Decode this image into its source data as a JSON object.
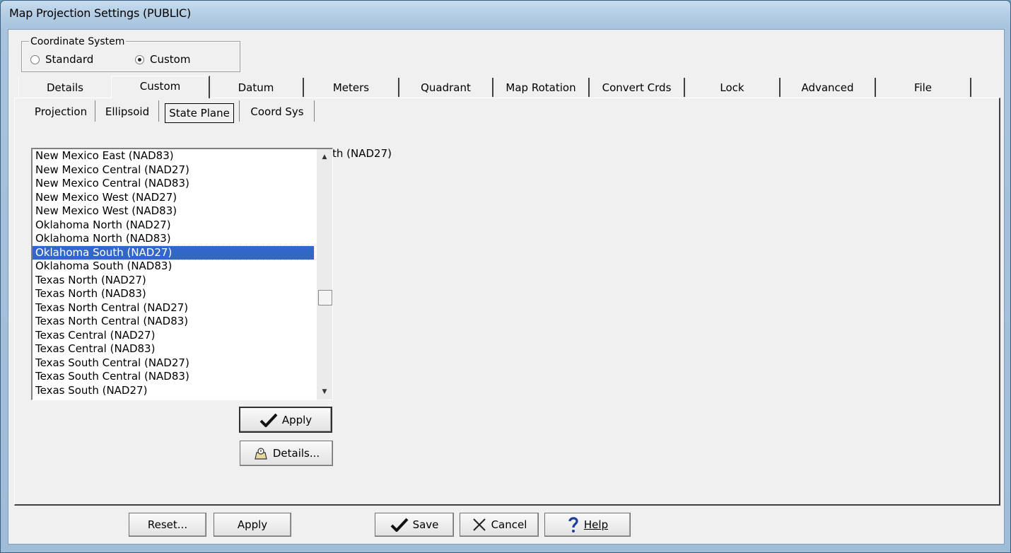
{
  "window": {
    "title": "Map Projection Settings (PUBLIC)"
  },
  "coordinate_system": {
    "legend": "Coordinate System",
    "options": [
      {
        "label": "Standard",
        "selected": false
      },
      {
        "label": "Custom",
        "selected": true
      }
    ]
  },
  "main_tabs": [
    "Details",
    "Custom",
    "Datum",
    "Meters",
    "Quadrant",
    "Map Rotation",
    "Convert Crds",
    "Lock",
    "Advanced",
    "File"
  ],
  "main_tabs_active": "Custom",
  "sub_tabs": [
    "Projection",
    "Ellipsoid",
    "State Plane",
    "Coord Sys"
  ],
  "sub_tabs_active": "State Plane",
  "state_plane_list": {
    "items": [
      "New Mexico East (NAD83)",
      "New Mexico Central (NAD27)",
      "New Mexico Central (NAD83)",
      "New Mexico West (NAD27)",
      "New Mexico West (NAD83)",
      "Oklahoma North (NAD27)",
      "Oklahoma North (NAD83)",
      "Oklahoma South (NAD27)",
      "Oklahoma South (NAD83)",
      "Texas North (NAD27)",
      "Texas North (NAD83)",
      "Texas North Central (NAD27)",
      "Texas North Central (NAD83)",
      "Texas Central (NAD27)",
      "Texas Central (NAD83)",
      "Texas South Central (NAD27)",
      "Texas South Central (NAD83)",
      "Texas South (NAD27)"
    ],
    "selected": "Oklahoma South (NAD27)",
    "behind_text": "th (NAD27)"
  },
  "panel_buttons": {
    "apply": "Apply",
    "details": "Details..."
  },
  "footer_buttons": {
    "reset": "Reset...",
    "apply": "Apply",
    "save": "Save",
    "cancel": "Cancel",
    "help": "Help"
  },
  "colors": {
    "selection": "#3267c7",
    "title_bar": "#b4cde4"
  }
}
